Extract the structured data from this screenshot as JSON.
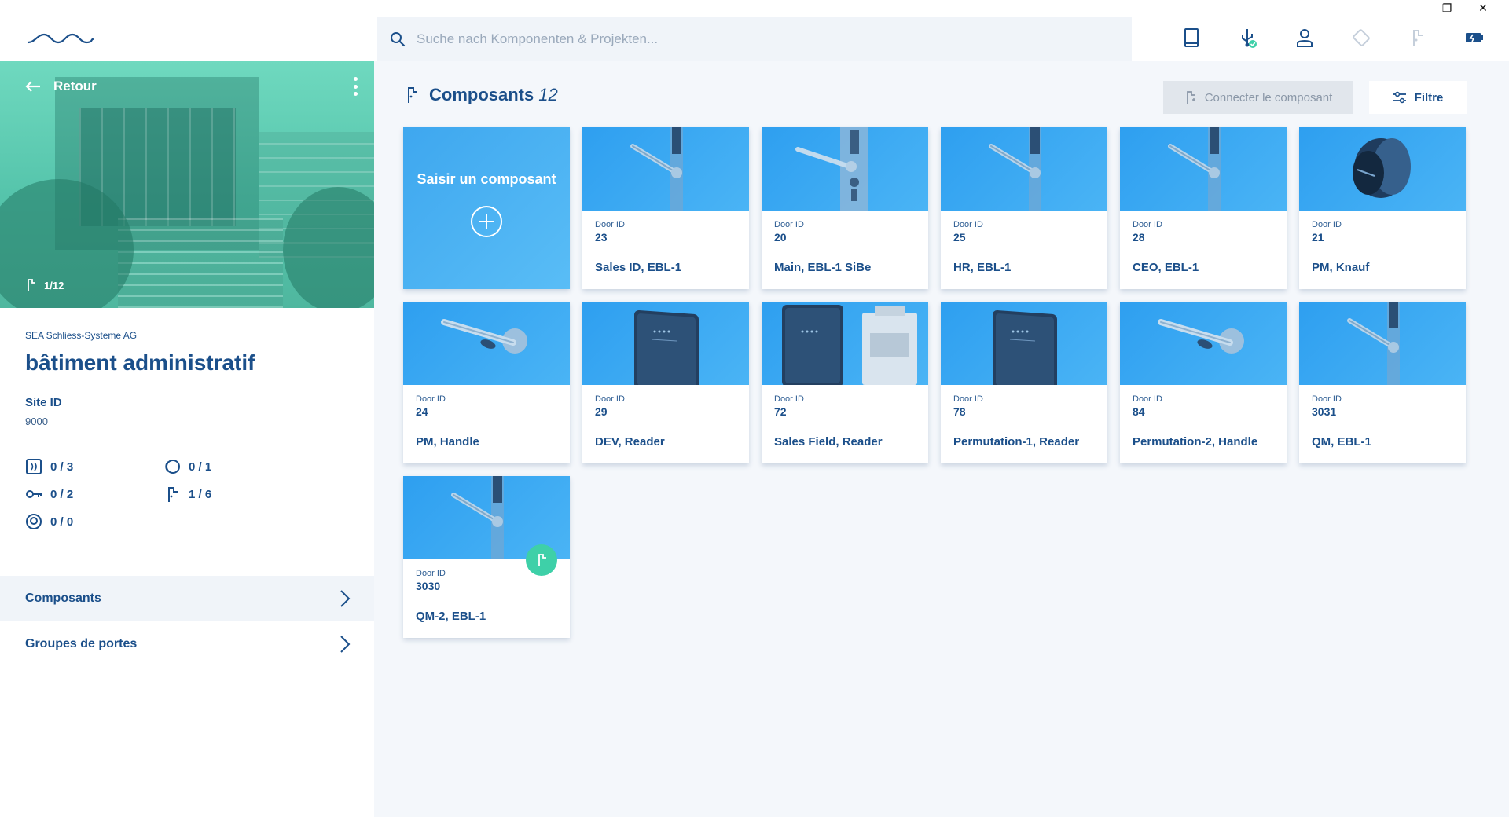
{
  "window": {
    "minimize": "–",
    "restore": "❐",
    "close": "✕"
  },
  "search": {
    "placeholder": "Suche nach Komponenten & Projekten..."
  },
  "top_icons": [
    "book-icon",
    "usb-connected-icon",
    "user-icon",
    "tag-icon",
    "handle-icon",
    "battery-icon"
  ],
  "sidebar": {
    "back_label": "Retour",
    "image_counter": "1/12",
    "organization": "SEA Schliess-Systeme AG",
    "site_title": "bâtiment administratif",
    "site_id_label": "Site ID",
    "site_id_value": "9000",
    "stats": {
      "readers": "0 / 3",
      "cylinders": "0 / 1",
      "keys": "0 / 2",
      "handles": "1 / 6",
      "other": "0 / 0"
    },
    "nav": [
      {
        "label": "Composants",
        "active": true
      },
      {
        "label": "Groupes de portes",
        "active": false
      }
    ]
  },
  "main": {
    "title": "Composants",
    "count": "12",
    "connect_button": "Connecter le composant",
    "filter_button": "Filtre",
    "add_card_label": "Saisir un composant",
    "door_id_label": "Door ID",
    "cards": [
      {
        "door_id": "23",
        "name": "Sales ID, EBL-1",
        "image": "handle-long"
      },
      {
        "door_id": "20",
        "name": "Main, EBL-1 SiBe",
        "image": "handle-sibe"
      },
      {
        "door_id": "25",
        "name": "HR, EBL-1",
        "image": "handle-long"
      },
      {
        "door_id": "28",
        "name": "CEO, EBL-1",
        "image": "handle-long"
      },
      {
        "door_id": "21",
        "name": "PM, Knauf",
        "image": "knob"
      },
      {
        "door_id": "24",
        "name": "PM, Handle",
        "image": "handle-short"
      },
      {
        "door_id": "29",
        "name": "DEV, Reader",
        "image": "reader"
      },
      {
        "door_id": "72",
        "name": "Sales Field, Reader",
        "image": "reader-module"
      },
      {
        "door_id": "78",
        "name": "Permutation-1, Reader",
        "image": "reader"
      },
      {
        "door_id": "84",
        "name": "Permutation-2, Handle",
        "image": "handle-short"
      },
      {
        "door_id": "3031",
        "name": "QM, EBL-1",
        "image": "handle-long"
      },
      {
        "door_id": "3030",
        "name": "QM-2, EBL-1",
        "image": "handle-long",
        "connected": true
      }
    ]
  },
  "colors": {
    "primary": "#1b4f8a",
    "card_blue": "#3ea7ef",
    "accent_green": "#3ed0a8",
    "hero_teal": "#5fcdb3"
  }
}
